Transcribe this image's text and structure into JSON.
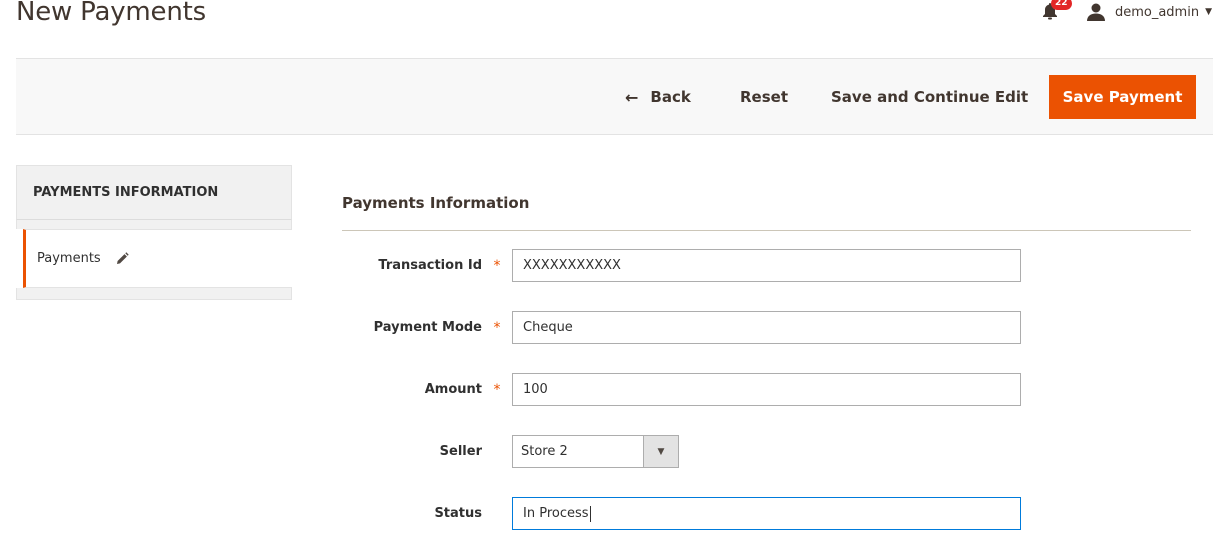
{
  "page": {
    "title": "New Payments"
  },
  "header": {
    "notifications_count": "22",
    "user_name": "demo_admin"
  },
  "toolbar": {
    "back_label": "Back",
    "reset_label": "Reset",
    "save_continue_label": "Save and Continue Edit",
    "save_label": "Save Payment"
  },
  "sidebar": {
    "heading": "PAYMENTS INFORMATION",
    "items": [
      {
        "label": "Payments",
        "active": true
      }
    ]
  },
  "form": {
    "section_title": "Payments Information",
    "fields": [
      {
        "label": "Transaction Id",
        "required": true,
        "value": "XXXXXXXXXXX",
        "type": "text"
      },
      {
        "label": "Payment Mode",
        "required": true,
        "value": "Cheque",
        "type": "text"
      },
      {
        "label": "Amount",
        "required": true,
        "value": "100",
        "type": "text"
      },
      {
        "label": "Seller",
        "required": false,
        "value": "Store 2",
        "type": "select"
      },
      {
        "label": "Status",
        "required": false,
        "value": "In Process",
        "type": "text",
        "focused": true
      }
    ],
    "required_marker": "*"
  },
  "colors": {
    "accent": "#eb5202",
    "focus": "#007bdb",
    "badge": "#e22626"
  }
}
